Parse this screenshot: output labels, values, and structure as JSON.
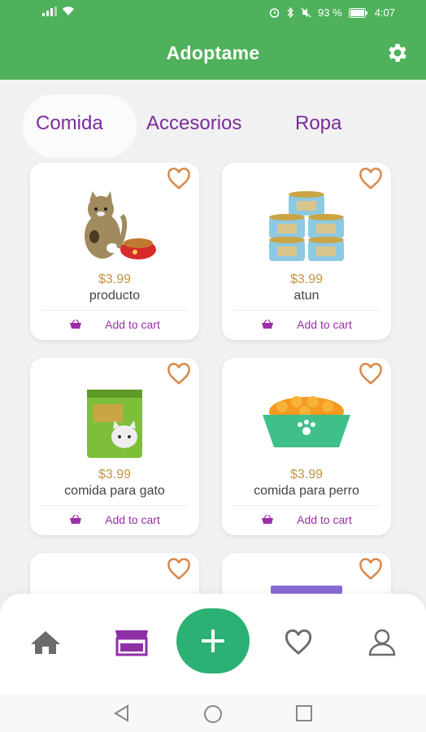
{
  "status_bar": {
    "battery_percent": "93 %",
    "time": "4:07"
  },
  "app": {
    "title": "Adoptame",
    "settings_icon": "gear-icon"
  },
  "tabs": [
    {
      "label": "Comida",
      "active": true
    },
    {
      "label": "Accesorios",
      "active": false
    },
    {
      "label": "Ropa",
      "active": false
    }
  ],
  "products": [
    {
      "price": "$3.99",
      "name": "producto",
      "cart_label": "Add to cart",
      "image": "cat-with-food-bowl"
    },
    {
      "price": "$3.99",
      "name": "atun",
      "cart_label": "Add to cart",
      "image": "tuna-cans"
    },
    {
      "price": "$3.99",
      "name": "comida para gato",
      "cart_label": "Add to cart",
      "image": "cat-food-bag"
    },
    {
      "price": "$3.99",
      "name": "comida para perro",
      "cart_label": "Add to cart",
      "image": "dog-food-bowl"
    },
    {
      "price": "",
      "name": "",
      "cart_label": "",
      "image": "cat-partial"
    },
    {
      "price": "",
      "name": "",
      "cart_label": "",
      "image": "purple-item-partial"
    }
  ],
  "colors": {
    "app_bar": "#4fb15b",
    "tab_text": "#7b2c9b",
    "price": "#c59445",
    "heart": "#d8894a",
    "cart": "#9c2ea9",
    "fab": "#2bb173"
  },
  "bottom_nav": [
    "home-icon",
    "store-icon",
    "add-icon",
    "heart-icon",
    "user-icon"
  ]
}
